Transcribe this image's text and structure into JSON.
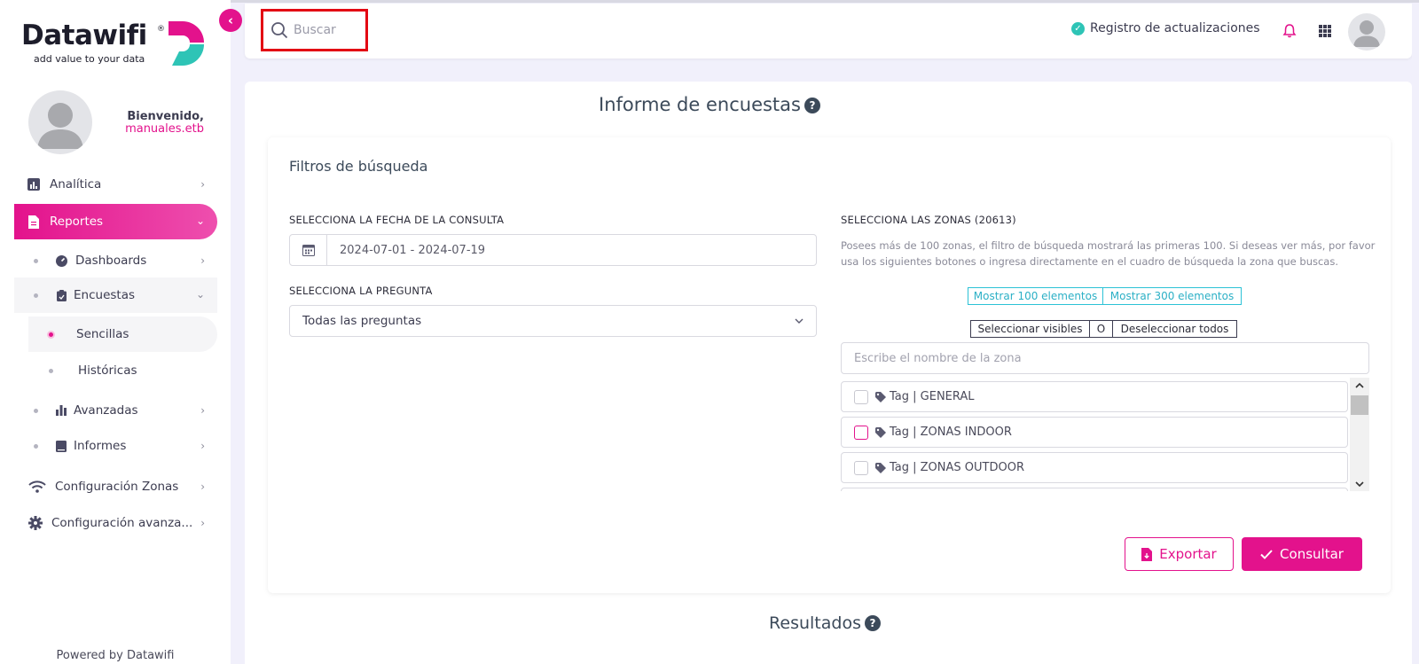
{
  "brand": {
    "name": "Datawifi",
    "registered": "®",
    "tagline": "add value to your data",
    "colors": {
      "primary": "#e3128c",
      "accent": "#2ec4b6"
    }
  },
  "user": {
    "welcome": "Bienvenido,",
    "name": "manuales.etb"
  },
  "sidebar": {
    "items": [
      {
        "label": "Analítica",
        "icon": "bar-chart-icon"
      },
      {
        "label": "Reportes",
        "icon": "document-icon"
      },
      {
        "label": "Dashboards",
        "icon": "gauge-icon"
      },
      {
        "label": "Encuestas",
        "icon": "clipboard-icon"
      },
      {
        "label": "Sencillas"
      },
      {
        "label": "Históricas"
      },
      {
        "label": "Avanzadas",
        "icon": "bar-chart-icon"
      },
      {
        "label": "Informes",
        "icon": "book-icon"
      },
      {
        "label": "Configuración Zonas",
        "icon": "wifi-icon"
      },
      {
        "label": "Configuración avanza...",
        "icon": "gear-icon"
      }
    ],
    "footer": "Powered by Datawifi"
  },
  "header": {
    "search_placeholder": "Buscar",
    "updates_label": "Registro de actualizaciones"
  },
  "main": {
    "title": "Informe de encuestas",
    "filters_title": "Filtros de búsqueda",
    "date_label": "SELECCIONA LA FECHA DE LA CONSULTA",
    "date_value": "2024-07-01 - 2024-07-19",
    "question_label": "SELECCIONA LA PREGUNTA",
    "question_value": "Todas las preguntas",
    "zones_label": "SELECCIONA LAS ZONAS (20613)",
    "zones_description": "Posees más de 100 zonas, el filtro de búsqueda mostrará las primeras 100. Si deseas ver más, por favor usa los siguientes botones o ingresa directamente en el cuadro de búsqueda la zona que buscas.",
    "show_100": "Mostrar 100 elementos",
    "show_300": "Mostrar 300 elementos",
    "select_visible": "Seleccionar visibles",
    "or": "O",
    "deselect_all": "Deseleccionar todos",
    "zone_search_placeholder": "Escribe el nombre de la zona",
    "zones": [
      {
        "label": "Tag | GENERAL"
      },
      {
        "label": "Tag | ZONAS INDOOR"
      },
      {
        "label": "Tag | ZONAS OUTDOOR"
      }
    ],
    "export_label": "Exportar",
    "query_label": "Consultar",
    "results_title": "Resultados"
  }
}
